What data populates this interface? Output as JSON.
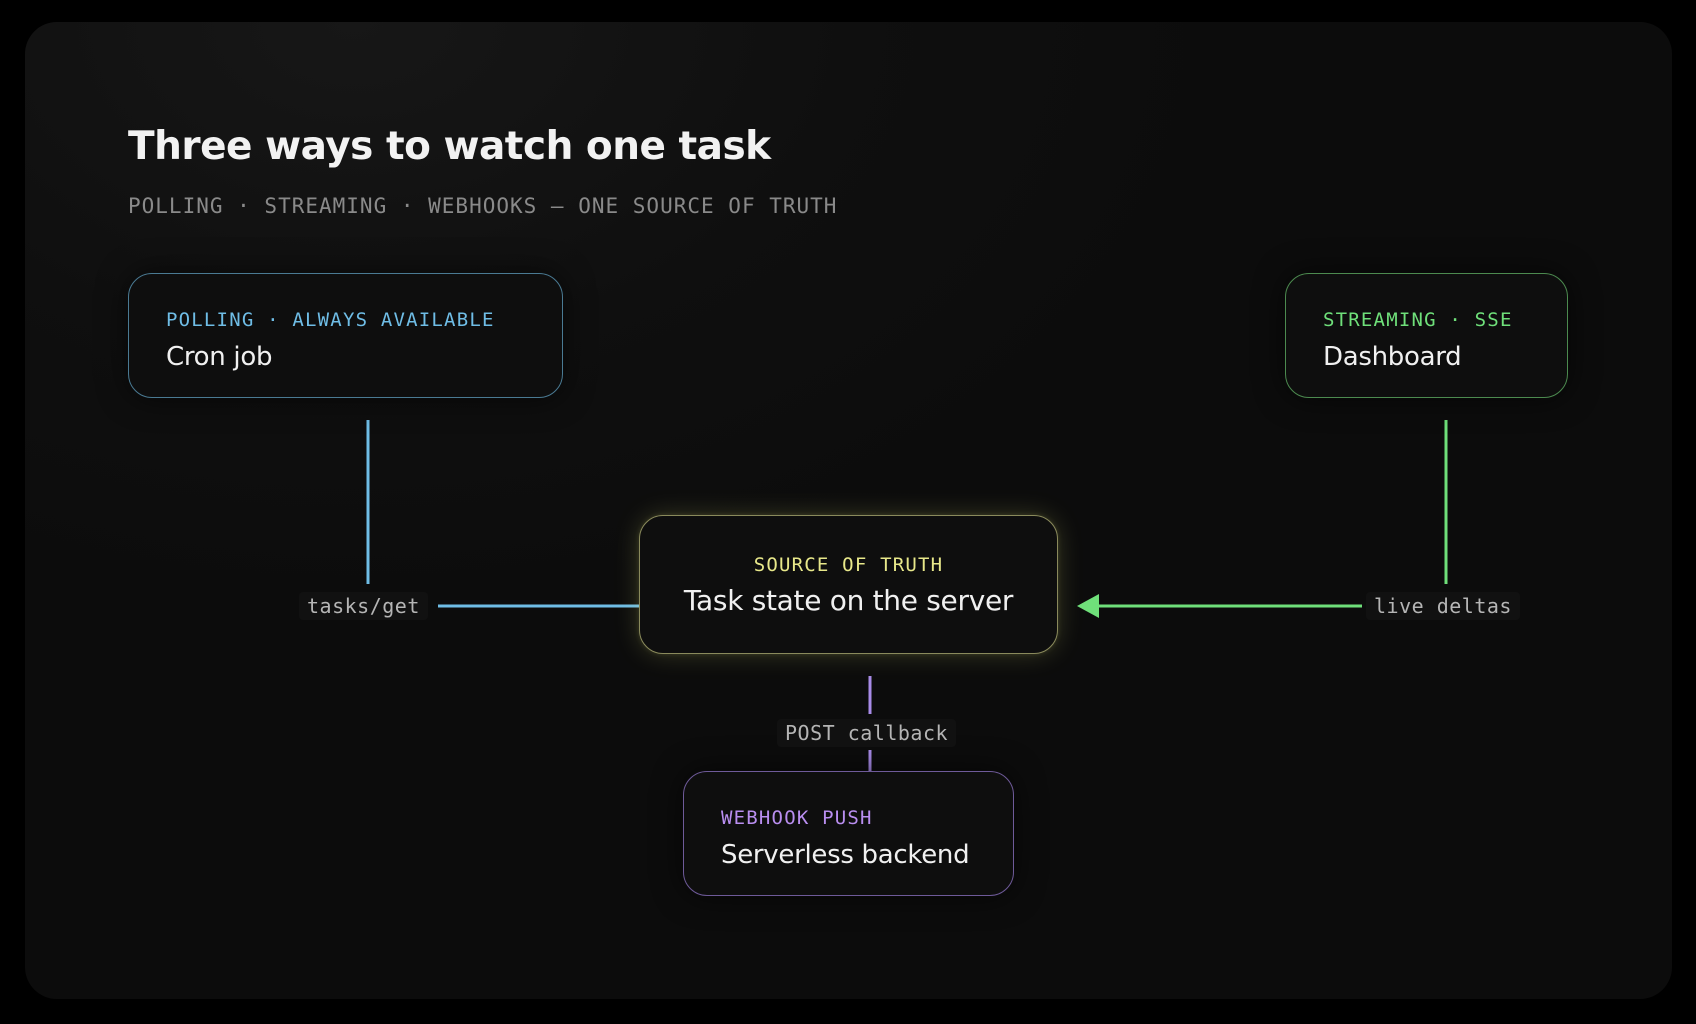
{
  "title": "Three ways to watch one task",
  "subtitle": "POLLING · STREAMING · WEBHOOKS — ONE SOURCE OF TRUTH",
  "nodes": {
    "polling": {
      "tag": "POLLING · ALWAYS AVAILABLE",
      "name": "Cron job"
    },
    "streaming": {
      "tag": "STREAMING · SSE",
      "name": "Dashboard"
    },
    "truth": {
      "tag": "SOURCE OF TRUTH",
      "name": "Task state on the server"
    },
    "webhook": {
      "tag": "WEBHOOK PUSH",
      "name": "Serverless backend"
    }
  },
  "edges": {
    "polling": {
      "label": "tasks/get"
    },
    "streaming": {
      "label": "live deltas"
    },
    "webhook": {
      "label": "POST callback"
    }
  },
  "colors": {
    "polling": "#6fbde6",
    "streaming": "#6fe07a",
    "truth": "#e8e88a",
    "webhook": "#b98ef0"
  }
}
